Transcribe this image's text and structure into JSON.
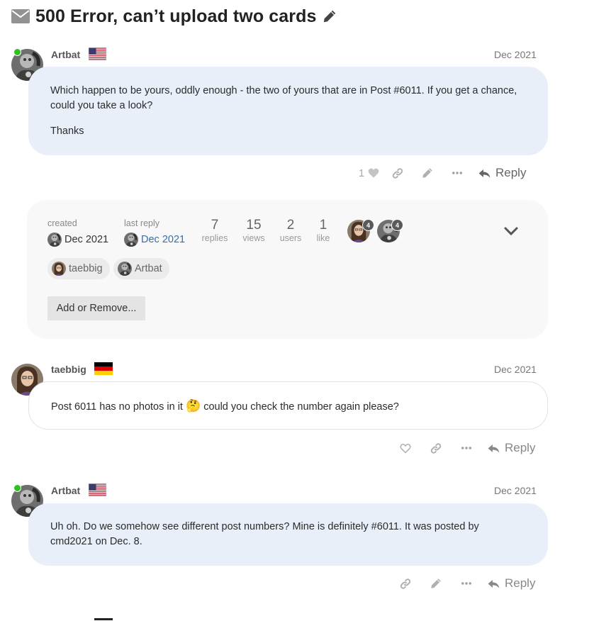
{
  "topic": {
    "title": "500 Error, can’t upload two cards",
    "icons": {
      "prefix": "envelope-icon",
      "suffix": "pencil-icon"
    }
  },
  "posts": [
    {
      "username": "Artbat",
      "flag": "us-flag-icon",
      "date": "Dec 2021",
      "online": true,
      "body": [
        "Which happen to be yours, oddly enough - the two of yours that are in Post #6011. If you get a chance, could you take a look?",
        "Thanks"
      ],
      "likes": "1",
      "reply_label": "Reply"
    },
    {
      "username": "taebbig",
      "flag": "de-flag-icon",
      "date": "Dec 2021",
      "online": false,
      "body_before_emoji": "Post 6011 has no photos in it",
      "emoji": "🤔",
      "body_after_emoji": "could you check the number again please?",
      "reply_label": "Reply"
    },
    {
      "username": "Artbat",
      "flag": "us-flag-icon",
      "date": "Dec 2021",
      "online": true,
      "body": [
        "Uh oh. Do we somehow see different post numbers? Mine is definitely #6011. It was posted by cmd2021 on Dec. 8."
      ],
      "reply_label": "Reply"
    }
  ],
  "topic_map": {
    "created_label": "created",
    "created_date": "Dec 2021",
    "last_reply_label": "last reply",
    "last_reply_date": "Dec 2021",
    "stats": [
      {
        "value": "7",
        "label": "replies"
      },
      {
        "value": "15",
        "label": "views"
      },
      {
        "value": "2",
        "label": "users"
      },
      {
        "value": "1",
        "label": "like"
      }
    ],
    "participants": [
      {
        "name": "taebbig",
        "count": "4"
      },
      {
        "name": "Artbat",
        "count": "4"
      }
    ],
    "tags": [
      "taebbig",
      "Artbat"
    ],
    "add_button": "Add or Remove..."
  },
  "colors": {
    "bubble_blue": "#e8eff8",
    "link": "#3a6ea5",
    "online": "#30c026",
    "icon_gray": "#999999"
  }
}
